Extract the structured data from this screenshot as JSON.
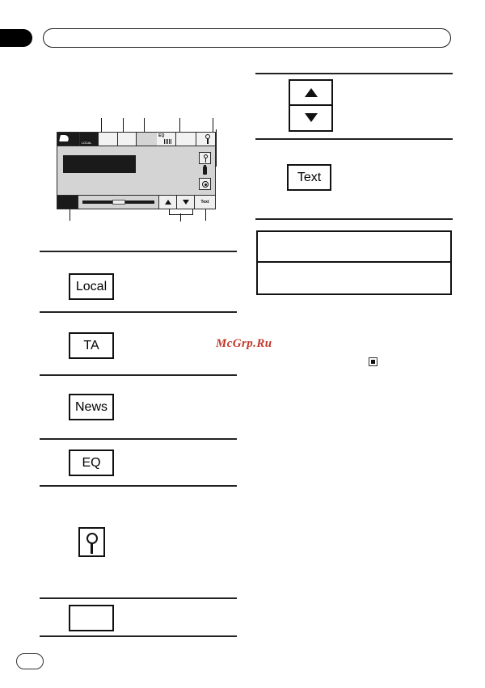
{
  "page": {
    "title": "Pioneer head unit display reference page",
    "header_bar_label": "",
    "page_number_label": ""
  },
  "device_diagram": {
    "name": "head-unit-display",
    "top_cells": [
      {
        "id": "disc",
        "label": "",
        "style": "dark-disc"
      },
      {
        "id": "cell-2",
        "label": "LOCAL",
        "style": "dark"
      },
      {
        "id": "cell-3",
        "label": "",
        "style": "light"
      },
      {
        "id": "cell-4",
        "label": "",
        "style": "light"
      },
      {
        "id": "cell-5",
        "label": "",
        "style": "light"
      },
      {
        "id": "spacer",
        "label": "",
        "style": "grey"
      },
      {
        "id": "eq",
        "label": "EQ",
        "style": "eq"
      },
      {
        "id": "cell-7",
        "label": "",
        "style": "light"
      },
      {
        "id": "key",
        "label": "",
        "style": "key"
      }
    ],
    "right_icons": [
      {
        "id": "key-icon",
        "name": "key-icon"
      },
      {
        "id": "battery-icon",
        "name": "battery-icon"
      },
      {
        "id": "circle-icon",
        "name": "circle-icon"
      }
    ],
    "bottom_row": {
      "dark_button_label": "",
      "progress_label": "",
      "up_button_label": "",
      "down_button_label": "",
      "text_button_label": "Text"
    }
  },
  "left_column": {
    "items": [
      {
        "id": "local",
        "label": "Local",
        "type": "keybox"
      },
      {
        "id": "ta",
        "label": "TA",
        "type": "keybox"
      },
      {
        "id": "news",
        "label": "News",
        "type": "keybox"
      },
      {
        "id": "eq",
        "label": "EQ",
        "type": "keybox"
      },
      {
        "id": "key-indicator",
        "label": "",
        "type": "key-icon"
      },
      {
        "id": "blank",
        "label": "",
        "type": "keybox-empty"
      }
    ]
  },
  "right_column": {
    "items": [
      {
        "id": "arrow-stack",
        "up_label": "",
        "down_label": "",
        "type": "arrow-stack"
      },
      {
        "id": "text",
        "label": "Text",
        "type": "keybox"
      },
      {
        "id": "table",
        "rows": [
          "",
          ""
        ],
        "type": "table"
      }
    ]
  },
  "watermark": {
    "text": "McGrp.Ru",
    "color": "#c0392b"
  },
  "marks": {
    "square_glyph_label": ""
  },
  "colors": {
    "ink": "#111111",
    "device_body": "#d4d4d4",
    "device_dark": "#1a1a1a",
    "watermark": "#c0392b"
  }
}
